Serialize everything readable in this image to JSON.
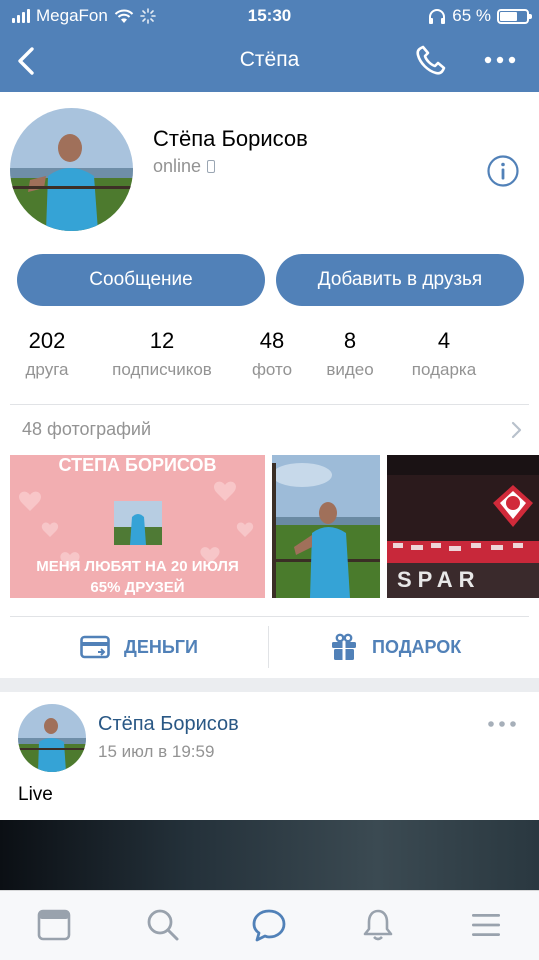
{
  "status_bar": {
    "carrier": "MegaFon",
    "time": "15:30",
    "battery": "65 %",
    "battery_level": 0.65
  },
  "nav": {
    "title": "Стёпа"
  },
  "profile": {
    "name": "Стёпа Борисов",
    "status": "online",
    "message_button": "Сообщение",
    "add_friend_button": "Добавить в друзья",
    "stats": [
      {
        "count": "202",
        "label": "друга"
      },
      {
        "count": "12",
        "label": "подписчиков"
      },
      {
        "count": "48",
        "label": "фото"
      },
      {
        "count": "8",
        "label": "видео"
      },
      {
        "count": "4",
        "label": "подарка"
      }
    ]
  },
  "photos": {
    "header": "48 фотографий",
    "banner_top": "СТЕПА БОРИСОВ",
    "banner_line1": "МЕНЯ ЛЮБЯТ НА 20 ИЮЛЯ",
    "banner_line2": "65% ДРУЗЕЙ",
    "stadium_text": "SPAR"
  },
  "actions": {
    "money": "ДЕНЬГИ",
    "gift": "ПОДАРОК"
  },
  "post": {
    "author": "Стёпа Борисов",
    "date": "15 июл в 19:59",
    "text": "Live"
  },
  "colors": {
    "brand": "#5181b8",
    "link": "#2a5885",
    "muted": "#939393"
  },
  "icons": {
    "tabs": [
      "news-icon",
      "search-icon",
      "messages-icon",
      "notifications-icon",
      "menu-icon"
    ]
  }
}
